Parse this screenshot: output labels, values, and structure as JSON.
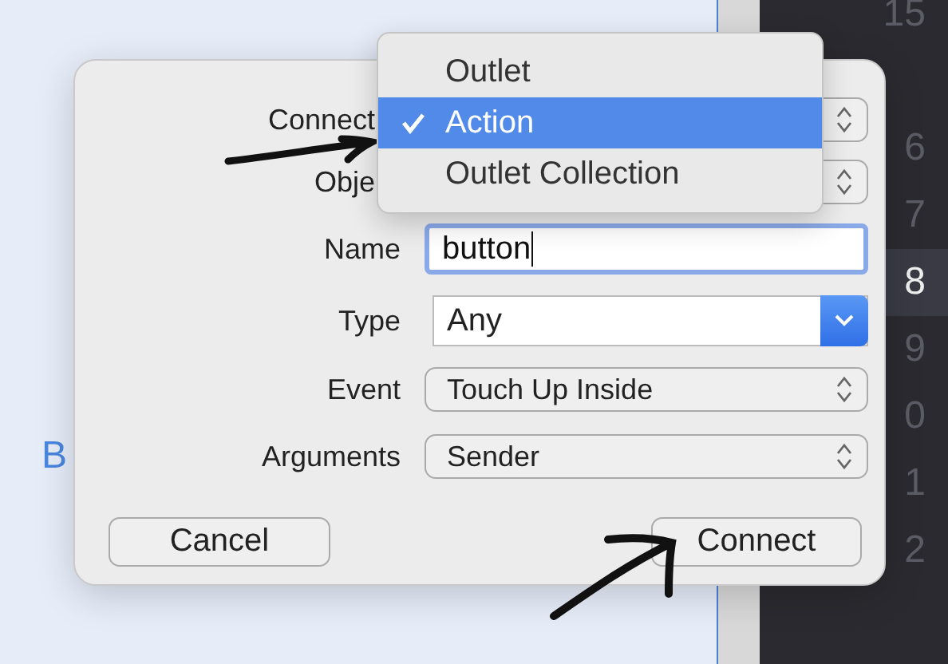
{
  "editor": {
    "left_text": "B",
    "line_numbers": [
      {
        "text": "15",
        "current": false
      },
      {
        "text": "6",
        "current": false
      },
      {
        "text": "7",
        "current": false
      },
      {
        "text": "8",
        "current": true
      },
      {
        "text": "9",
        "current": false
      },
      {
        "text": "0",
        "current": false
      },
      {
        "text": "1",
        "current": false
      },
      {
        "text": "2",
        "current": false
      }
    ]
  },
  "dialog": {
    "fields": [
      {
        "kind": "popup",
        "label": "Connect"
      },
      {
        "kind": "popup",
        "label": "Obje"
      },
      {
        "kind": "text",
        "label": "Name",
        "value": "button"
      },
      {
        "kind": "combo",
        "label": "Type",
        "value": "Any"
      },
      {
        "kind": "popup",
        "label": "Event",
        "value": "Touch Up Inside"
      },
      {
        "kind": "popup",
        "label": "Arguments",
        "value": "Sender"
      }
    ],
    "buttons": [
      "Cancel",
      "Connect"
    ]
  },
  "menu": {
    "items": [
      {
        "label": "Outlet",
        "selected": false
      },
      {
        "label": "Action",
        "selected": true
      },
      {
        "label": "Outlet Collection",
        "selected": false
      }
    ]
  }
}
